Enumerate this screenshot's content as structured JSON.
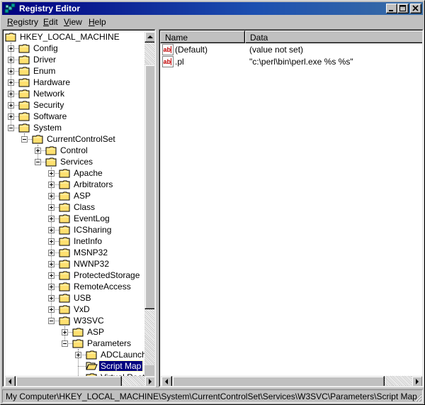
{
  "window": {
    "title": "Registry Editor"
  },
  "menu": [
    {
      "label": "Registry",
      "accel": "R",
      "rest": "egistry"
    },
    {
      "label": "Edit",
      "accel": "E",
      "rest": "dit"
    },
    {
      "label": "View",
      "accel": "V",
      "rest": "iew"
    },
    {
      "label": "Help",
      "accel": "H",
      "rest": "elp"
    }
  ],
  "tree": {
    "root": "HKEY_LOCAL_MACHINE",
    "items": [
      {
        "label": "Config",
        "level": 1,
        "expander": "plus"
      },
      {
        "label": "Driver",
        "level": 1,
        "expander": "plus"
      },
      {
        "label": "Enum",
        "level": 1,
        "expander": "plus"
      },
      {
        "label": "Hardware",
        "level": 1,
        "expander": "plus"
      },
      {
        "label": "Network",
        "level": 1,
        "expander": "plus"
      },
      {
        "label": "Security",
        "level": 1,
        "expander": "plus"
      },
      {
        "label": "Software",
        "level": 1,
        "expander": "plus"
      },
      {
        "label": "System",
        "level": 1,
        "expander": "minus"
      },
      {
        "label": "CurrentControlSet",
        "level": 2,
        "expander": "minus"
      },
      {
        "label": "Control",
        "level": 3,
        "expander": "plus"
      },
      {
        "label": "Services",
        "level": 3,
        "expander": "minus"
      },
      {
        "label": "Apache",
        "level": 4,
        "expander": "plus"
      },
      {
        "label": "Arbitrators",
        "level": 4,
        "expander": "plus"
      },
      {
        "label": "ASP",
        "level": 4,
        "expander": "plus"
      },
      {
        "label": "Class",
        "level": 4,
        "expander": "plus"
      },
      {
        "label": "EventLog",
        "level": 4,
        "expander": "plus"
      },
      {
        "label": "ICSharing",
        "level": 4,
        "expander": "plus"
      },
      {
        "label": "InetInfo",
        "level": 4,
        "expander": "plus"
      },
      {
        "label": "MSNP32",
        "level": 4,
        "expander": "plus"
      },
      {
        "label": "NWNP32",
        "level": 4,
        "expander": "plus"
      },
      {
        "label": "ProtectedStorage",
        "level": 4,
        "expander": "plus"
      },
      {
        "label": "RemoteAccess",
        "level": 4,
        "expander": "plus"
      },
      {
        "label": "USB",
        "level": 4,
        "expander": "plus"
      },
      {
        "label": "VxD",
        "level": 4,
        "expander": "plus"
      },
      {
        "label": "W3SVC",
        "level": 4,
        "expander": "minus"
      },
      {
        "label": "ASP",
        "level": 5,
        "expander": "plus"
      },
      {
        "label": "Parameters",
        "level": 5,
        "expander": "minus"
      },
      {
        "label": "ADCLaunch",
        "level": 6,
        "expander": "plus"
      },
      {
        "label": "Script Map",
        "level": 6,
        "expander": "none",
        "selected": true,
        "open": true
      },
      {
        "label": "Virtual Roots",
        "level": 6,
        "expander": "none"
      }
    ]
  },
  "list": {
    "columns": [
      "Name",
      "Data"
    ],
    "rows": [
      {
        "name": "(Default)",
        "data": "(value not set)"
      },
      {
        "name": ".pl",
        "data": "\"c:\\perl\\bin\\perl.exe %s %s\""
      }
    ]
  },
  "status": {
    "path": "My Computer\\HKEY_LOCAL_MACHINE\\System\\CurrentControlSet\\Services\\W3SVC\\Parameters\\Script Map"
  },
  "colors": {
    "titlebar_start": "#000080",
    "titlebar_end": "#3a6ea5",
    "folder": "#ffe070",
    "selection": "#000080"
  },
  "icons": {
    "folder": "folder-icon",
    "value": "string-value-icon",
    "app": "registry-editor-icon"
  }
}
